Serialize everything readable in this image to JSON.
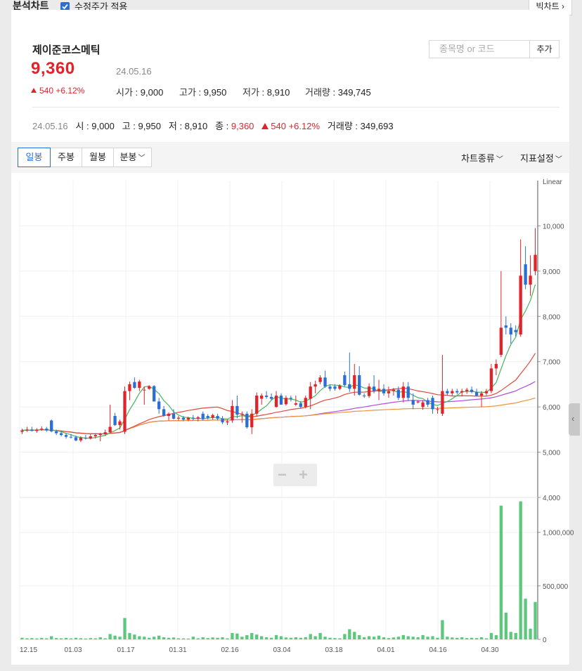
{
  "header": {
    "title": "분석차트",
    "adjusted_label": "수정주가 적용",
    "big_chart_label": "빅차트"
  },
  "stock": {
    "name": "제이준코스메틱",
    "price": "9,360",
    "date": "24.05.16",
    "change": "540 +6.12%",
    "open_label": "시가",
    "open": "9,000",
    "high_label": "고가",
    "high": "9,950",
    "low_label": "저가",
    "low": "8,910",
    "volume_label": "거래량",
    "volume": "349,745"
  },
  "search": {
    "placeholder": "종목명 or 코드",
    "add_label": "추가"
  },
  "info": {
    "date": "24.05.16",
    "o_label": "시",
    "o": "9,000",
    "h_label": "고",
    "h": "9,950",
    "l_label": "저",
    "l": "8,910",
    "c_label": "종",
    "c": "9,360",
    "change": "540 +6.12%",
    "vol_label": "거래량",
    "vol": "349,693"
  },
  "toolbar": {
    "periods": [
      "일봉",
      "주봉",
      "월봉",
      "분봉"
    ],
    "active_period": "일봉",
    "chart_type": "차트종류",
    "indicator": "지표설정"
  },
  "colors": {
    "up": "#e2232a",
    "down": "#2b6fd6",
    "volume": "#5cc87c",
    "ma5": "#46b45a",
    "ma20": "#e04a3a",
    "ma60": "#b04de0",
    "ma120": "#f0923a"
  },
  "chart_data": {
    "type": "candlestick",
    "price_axis": {
      "scale_label": "Linear",
      "ticks": [
        10000,
        9000,
        8000,
        7000,
        6000,
        5000,
        4000
      ],
      "tick_labels": [
        "10,000",
        "9,000",
        "8,000",
        "7,000",
        "6,000",
        "5,000",
        "4,000"
      ],
      "range": [
        4000,
        11000
      ]
    },
    "volume_axis": {
      "ticks": [
        1000000,
        500000,
        0
      ],
      "tick_labels": [
        "1,000,000",
        "500,000",
        "0"
      ],
      "range": [
        0,
        1300000
      ]
    },
    "x_tick_labels": [
      "12.15",
      "01.03",
      "01.17",
      "01.31",
      "02.16",
      "03.04",
      "03.18",
      "04.01",
      "04.16",
      "04.30"
    ],
    "candles": [
      {
        "o": 5450,
        "h": 5520,
        "l": 5400,
        "c": 5480,
        "v": 15000
      },
      {
        "o": 5480,
        "h": 5560,
        "l": 5450,
        "c": 5500,
        "v": 10000
      },
      {
        "o": 5500,
        "h": 5560,
        "l": 5460,
        "c": 5470,
        "v": 12000
      },
      {
        "o": 5470,
        "h": 5530,
        "l": 5430,
        "c": 5500,
        "v": 9000
      },
      {
        "o": 5500,
        "h": 5570,
        "l": 5470,
        "c": 5520,
        "v": 14000
      },
      {
        "o": 5520,
        "h": 5560,
        "l": 5450,
        "c": 5480,
        "v": 10000
      },
      {
        "o": 5700,
        "h": 5720,
        "l": 5440,
        "c": 5460,
        "v": 30000
      },
      {
        "o": 5460,
        "h": 5500,
        "l": 5380,
        "c": 5420,
        "v": 12000
      },
      {
        "o": 5420,
        "h": 5460,
        "l": 5350,
        "c": 5380,
        "v": 10000
      },
      {
        "o": 5380,
        "h": 5420,
        "l": 5300,
        "c": 5340,
        "v": 14000
      },
      {
        "o": 5340,
        "h": 5400,
        "l": 5300,
        "c": 5330,
        "v": 9000
      },
      {
        "o": 5330,
        "h": 5370,
        "l": 5240,
        "c": 5260,
        "v": 15000
      },
      {
        "o": 5260,
        "h": 5350,
        "l": 5220,
        "c": 5320,
        "v": 11000
      },
      {
        "o": 5320,
        "h": 5380,
        "l": 5280,
        "c": 5300,
        "v": 8000
      },
      {
        "o": 5300,
        "h": 5400,
        "l": 5280,
        "c": 5350,
        "v": 12000
      },
      {
        "o": 5350,
        "h": 5420,
        "l": 5300,
        "c": 5380,
        "v": 10000
      },
      {
        "o": 5380,
        "h": 5430,
        "l": 5240,
        "c": 5400,
        "v": 20000
      },
      {
        "o": 5400,
        "h": 5500,
        "l": 5360,
        "c": 5440,
        "v": 10000
      },
      {
        "o": 5440,
        "h": 6050,
        "l": 5420,
        "c": 5560,
        "v": 50000
      },
      {
        "o": 5800,
        "h": 5870,
        "l": 5580,
        "c": 5600,
        "v": 35000
      },
      {
        "o": 5600,
        "h": 5720,
        "l": 5500,
        "c": 5680,
        "v": 25000
      },
      {
        "o": 5450,
        "h": 6450,
        "l": 5400,
        "c": 6350,
        "v": 200000
      },
      {
        "o": 6350,
        "h": 6560,
        "l": 6150,
        "c": 6500,
        "v": 60000
      },
      {
        "o": 6550,
        "h": 6650,
        "l": 6400,
        "c": 6420,
        "v": 45000
      },
      {
        "o": 6420,
        "h": 6600,
        "l": 6350,
        "c": 6560,
        "v": 30000
      },
      {
        "o": 6380,
        "h": 6450,
        "l": 6050,
        "c": 6380,
        "v": 25000
      },
      {
        "o": 6400,
        "h": 6480,
        "l": 6380,
        "c": 6450,
        "v": 15000
      },
      {
        "o": 6460,
        "h": 6480,
        "l": 6120,
        "c": 6120,
        "v": 25000
      },
      {
        "o": 6120,
        "h": 6200,
        "l": 5850,
        "c": 5950,
        "v": 35000
      },
      {
        "o": 5950,
        "h": 6020,
        "l": 5780,
        "c": 5800,
        "v": 20000
      },
      {
        "o": 5800,
        "h": 5880,
        "l": 5700,
        "c": 5850,
        "v": 15000
      },
      {
        "o": 5850,
        "h": 5950,
        "l": 5720,
        "c": 5740,
        "v": 18000
      },
      {
        "o": 5740,
        "h": 5800,
        "l": 5700,
        "c": 5760,
        "v": 10000
      },
      {
        "o": 5760,
        "h": 5800,
        "l": 5680,
        "c": 5720,
        "v": 9000
      },
      {
        "o": 5720,
        "h": 5780,
        "l": 5680,
        "c": 5760,
        "v": 8000
      },
      {
        "o": 5760,
        "h": 5820,
        "l": 5700,
        "c": 5740,
        "v": 25000
      },
      {
        "o": 5740,
        "h": 5800,
        "l": 5680,
        "c": 5770,
        "v": 10000
      },
      {
        "o": 5850,
        "h": 5900,
        "l": 5700,
        "c": 5730,
        "v": 20000
      },
      {
        "o": 5800,
        "h": 5840,
        "l": 5720,
        "c": 5760,
        "v": 12000
      },
      {
        "o": 5760,
        "h": 5850,
        "l": 5720,
        "c": 5820,
        "v": 18000
      },
      {
        "o": 5800,
        "h": 5850,
        "l": 5700,
        "c": 5740,
        "v": 15000
      },
      {
        "o": 5740,
        "h": 5800,
        "l": 5620,
        "c": 5660,
        "v": 20000
      },
      {
        "o": 5660,
        "h": 5720,
        "l": 5600,
        "c": 5680,
        "v": 10000
      },
      {
        "o": 5700,
        "h": 6150,
        "l": 5650,
        "c": 6020,
        "v": 60000
      },
      {
        "o": 6020,
        "h": 6250,
        "l": 5750,
        "c": 5830,
        "v": 55000
      },
      {
        "o": 5830,
        "h": 5900,
        "l": 5650,
        "c": 5850,
        "v": 25000
      },
      {
        "o": 5850,
        "h": 5900,
        "l": 5520,
        "c": 5550,
        "v": 40000
      },
      {
        "o": 5550,
        "h": 5950,
        "l": 5400,
        "c": 5850,
        "v": 60000
      },
      {
        "o": 5850,
        "h": 6320,
        "l": 5800,
        "c": 6250,
        "v": 45000
      },
      {
        "o": 6180,
        "h": 6300,
        "l": 6050,
        "c": 6250,
        "v": 30000
      },
      {
        "o": 6250,
        "h": 6350,
        "l": 6180,
        "c": 6220,
        "v": 20000
      },
      {
        "o": 6220,
        "h": 6300,
        "l": 6150,
        "c": 6180,
        "v": 15000
      },
      {
        "o": 6000,
        "h": 6350,
        "l": 5980,
        "c": 6250,
        "v": 40000
      },
      {
        "o": 6250,
        "h": 6300,
        "l": 6050,
        "c": 6050,
        "v": 30000
      },
      {
        "o": 6060,
        "h": 6250,
        "l": 6030,
        "c": 6200,
        "v": 18000
      },
      {
        "o": 6200,
        "h": 6250,
        "l": 6120,
        "c": 6180,
        "v": 15000
      },
      {
        "o": 6050,
        "h": 6250,
        "l": 6020,
        "c": 6080,
        "v": 20000
      },
      {
        "o": 6080,
        "h": 6130,
        "l": 5960,
        "c": 6000,
        "v": 15000
      },
      {
        "o": 6000,
        "h": 6250,
        "l": 5970,
        "c": 6200,
        "v": 20000
      },
      {
        "o": 6180,
        "h": 6550,
        "l": 5950,
        "c": 6450,
        "v": 50000
      },
      {
        "o": 6450,
        "h": 6580,
        "l": 6300,
        "c": 6500,
        "v": 30000
      },
      {
        "o": 6550,
        "h": 6700,
        "l": 6500,
        "c": 6650,
        "v": 60000
      },
      {
        "o": 6650,
        "h": 6800,
        "l": 6420,
        "c": 6450,
        "v": 25000
      },
      {
        "o": 6450,
        "h": 6500,
        "l": 6350,
        "c": 6400,
        "v": 15000
      },
      {
        "o": 6450,
        "h": 6500,
        "l": 6360,
        "c": 6400,
        "v": 12000
      },
      {
        "o": 6400,
        "h": 6500,
        "l": 6370,
        "c": 6470,
        "v": 10000
      },
      {
        "o": 6700,
        "h": 6780,
        "l": 6450,
        "c": 6480,
        "v": 50000
      },
      {
        "o": 6500,
        "h": 7200,
        "l": 6330,
        "c": 6400,
        "v": 95000
      },
      {
        "o": 6400,
        "h": 6950,
        "l": 6250,
        "c": 6700,
        "v": 70000
      },
      {
        "o": 6700,
        "h": 6900,
        "l": 6250,
        "c": 6270,
        "v": 40000
      },
      {
        "o": 6250,
        "h": 6300,
        "l": 6200,
        "c": 6240,
        "v": 20000
      },
      {
        "o": 6240,
        "h": 6520,
        "l": 6200,
        "c": 6450,
        "v": 30000
      },
      {
        "o": 6450,
        "h": 6700,
        "l": 6300,
        "c": 6350,
        "v": 25000
      },
      {
        "o": 6350,
        "h": 6600,
        "l": 6150,
        "c": 6400,
        "v": 35000
      },
      {
        "o": 6400,
        "h": 6500,
        "l": 6250,
        "c": 6300,
        "v": 20000
      },
      {
        "o": 6300,
        "h": 6450,
        "l": 6200,
        "c": 6350,
        "v": 12000
      },
      {
        "o": 6350,
        "h": 6420,
        "l": 6250,
        "c": 6380,
        "v": 18000
      },
      {
        "o": 6380,
        "h": 6450,
        "l": 6150,
        "c": 6200,
        "v": 25000
      },
      {
        "o": 6200,
        "h": 6550,
        "l": 6100,
        "c": 6450,
        "v": 40000
      },
      {
        "o": 6450,
        "h": 6550,
        "l": 6130,
        "c": 6200,
        "v": 30000
      },
      {
        "o": 6150,
        "h": 6300,
        "l": 5950,
        "c": 6050,
        "v": 25000
      },
      {
        "o": 6100,
        "h": 6150,
        "l": 6080,
        "c": 6120,
        "v": 20000
      },
      {
        "o": 6000,
        "h": 6150,
        "l": 5940,
        "c": 6100,
        "v": 40000
      },
      {
        "o": 6150,
        "h": 6200,
        "l": 6000,
        "c": 6050,
        "v": 25000
      },
      {
        "o": 6200,
        "h": 6250,
        "l": 5850,
        "c": 5950,
        "v": 30000
      },
      {
        "o": 5950,
        "h": 6000,
        "l": 5850,
        "c": 5950,
        "v": 15000
      },
      {
        "o": 5850,
        "h": 7150,
        "l": 5800,
        "c": 6350,
        "v": 180000
      },
      {
        "o": 6350,
        "h": 6400,
        "l": 6250,
        "c": 6300,
        "v": 25000
      },
      {
        "o": 6300,
        "h": 6400,
        "l": 6250,
        "c": 6350,
        "v": 18000
      },
      {
        "o": 6350,
        "h": 6400,
        "l": 6280,
        "c": 6320,
        "v": 15000
      },
      {
        "o": 6320,
        "h": 6400,
        "l": 6230,
        "c": 6350,
        "v": 20000
      },
      {
        "o": 6350,
        "h": 6420,
        "l": 6290,
        "c": 6380,
        "v": 12000
      },
      {
        "o": 6380,
        "h": 6450,
        "l": 6300,
        "c": 6330,
        "v": 15000
      },
      {
        "o": 6330,
        "h": 6400,
        "l": 6230,
        "c": 6250,
        "v": 12000
      },
      {
        "o": 6250,
        "h": 6350,
        "l": 6000,
        "c": 6300,
        "v": 20000
      },
      {
        "o": 6300,
        "h": 6400,
        "l": 6250,
        "c": 6350,
        "v": 10000
      },
      {
        "o": 6350,
        "h": 6950,
        "l": 6300,
        "c": 6850,
        "v": 60000
      },
      {
        "o": 6850,
        "h": 7050,
        "l": 6700,
        "c": 6950,
        "v": 40000
      },
      {
        "o": 7150,
        "h": 9000,
        "l": 7100,
        "c": 7750,
        "v": 1250000
      },
      {
        "o": 7800,
        "h": 8000,
        "l": 7600,
        "c": 7750,
        "v": 250000
      },
      {
        "o": 7750,
        "h": 7850,
        "l": 7400,
        "c": 7600,
        "v": 70000
      },
      {
        "o": 7700,
        "h": 7800,
        "l": 7550,
        "c": 7650,
        "v": 60000
      },
      {
        "o": 7600,
        "h": 9700,
        "l": 7550,
        "c": 8900,
        "v": 1290000
      },
      {
        "o": 9150,
        "h": 9550,
        "l": 8600,
        "c": 8700,
        "v": 380000
      },
      {
        "o": 8700,
        "h": 9350,
        "l": 8450,
        "c": 8900,
        "v": 100000
      },
      {
        "o": 9000,
        "h": 9950,
        "l": 8910,
        "c": 9360,
        "v": 349693
      }
    ]
  }
}
